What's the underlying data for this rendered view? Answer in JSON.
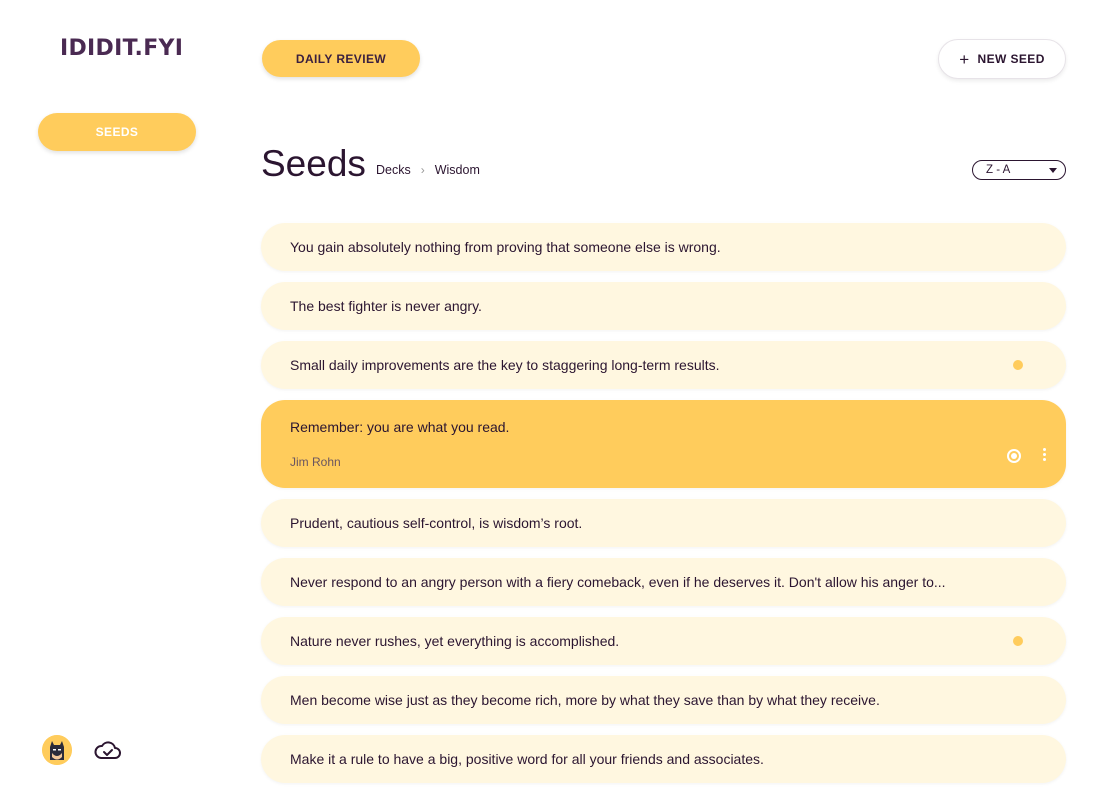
{
  "app": {
    "logo": "IDIDIT.FYI"
  },
  "sidebar": {
    "nav_seeds_label": "SEEDS"
  },
  "header": {
    "daily_review_label": "DAILY REVIEW",
    "new_seed_icon": "plus-icon",
    "new_seed_label": "NEW SEED"
  },
  "page": {
    "title": "Seeds",
    "breadcrumb": [
      "Decks",
      "Wisdom"
    ],
    "sort": {
      "selected": "Z - A"
    }
  },
  "seeds": [
    {
      "text": "You gain absolutely nothing from proving that someone else is wrong.",
      "dot": false
    },
    {
      "text": "The best fighter is never angry.",
      "dot": false
    },
    {
      "text": "Small daily improvements are the key to staggering long-term results.",
      "dot": true
    },
    {
      "text": "Remember: you are what you read.",
      "author": "Jim Rohn",
      "active": true
    },
    {
      "text": "Prudent, cautious self-control, is wisdom’s root.",
      "dot": false
    },
    {
      "text": "Never respond to an angry person with a fiery comeback, even if he deserves it. Don't allow his anger to...",
      "dot": false
    },
    {
      "text": "Nature never rushes, yet everything is accomplished.",
      "dot": true
    },
    {
      "text": "Men become wise just as they become rich, more by what they save than by what they receive.",
      "dot": false
    },
    {
      "text": "Make it a rule to have a big, positive word for all your friends and associates.",
      "dot": false
    }
  ],
  "footer": {
    "avatar_icon": "batman-avatar-icon",
    "sync_icon": "cloud-check-icon"
  },
  "colors": {
    "accent": "#ffcc5c",
    "seed_bg": "#fff7e0",
    "text": "#2b1530"
  }
}
